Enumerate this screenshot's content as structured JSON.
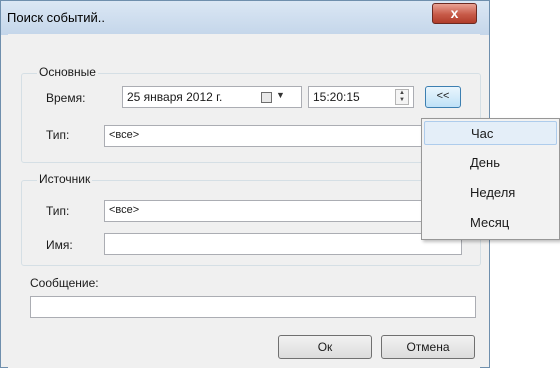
{
  "window": {
    "title": "Поиск событий..",
    "close_glyph": "x"
  },
  "main_group": {
    "label": "Основные",
    "time_label": "Время:",
    "date_value": "25  января  2012 г.",
    "time_value": "15:20:15",
    "toggle_label": "<<",
    "type_label": "Тип:",
    "type_value": "<все>"
  },
  "source_group": {
    "label": "Источник",
    "type_label": "Тип:",
    "type_value": "<все>",
    "name_label": "Имя:",
    "name_value": ""
  },
  "message": {
    "label": "Сообщение:",
    "value": ""
  },
  "buttons": {
    "ok": "Ок",
    "cancel": "Отмена"
  },
  "period_menu": {
    "items": [
      "Час",
      "День",
      "Неделя",
      "Месяц"
    ],
    "selected": "Час"
  },
  "colors": {
    "title_bg": "#c9dbee",
    "close_red": "#c75a48",
    "selection": "#e4eef8"
  }
}
